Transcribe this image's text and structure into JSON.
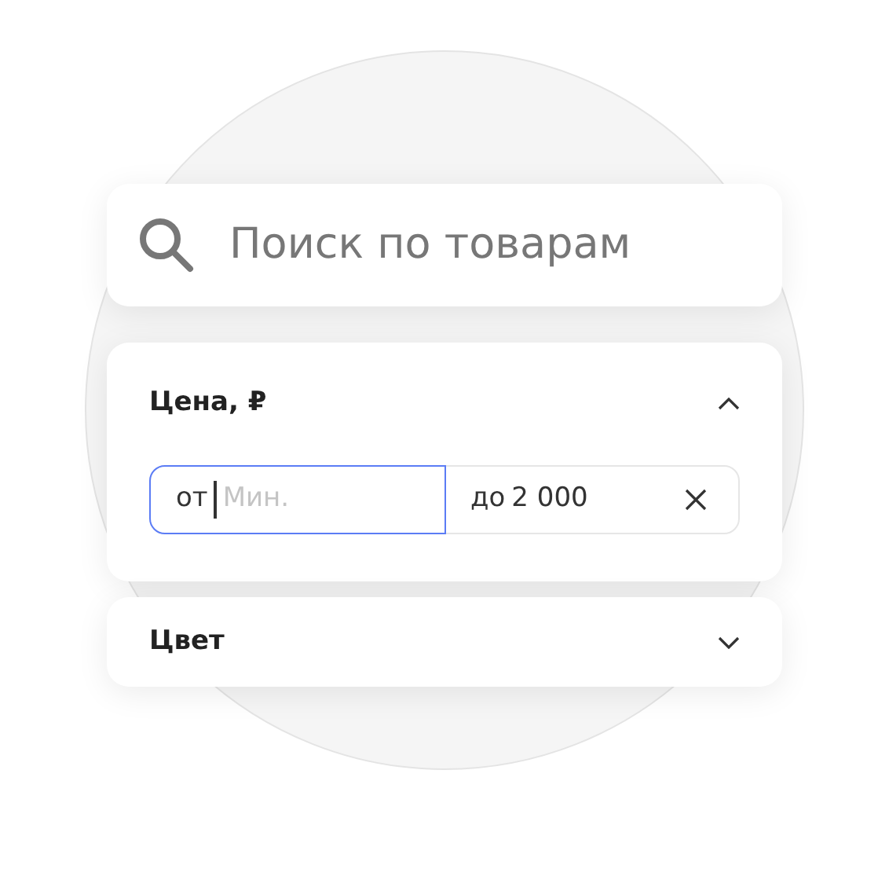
{
  "search": {
    "placeholder": "Поиск по товарам"
  },
  "filters": [
    {
      "title": "Цена, ₽",
      "expanded": true,
      "from": {
        "prefix": "от",
        "placeholder": "Мин.",
        "focused": true
      },
      "to": {
        "prefix": "до",
        "value": "2 000",
        "focused": false
      }
    },
    {
      "title": "Цвет",
      "expanded": false
    }
  ]
}
